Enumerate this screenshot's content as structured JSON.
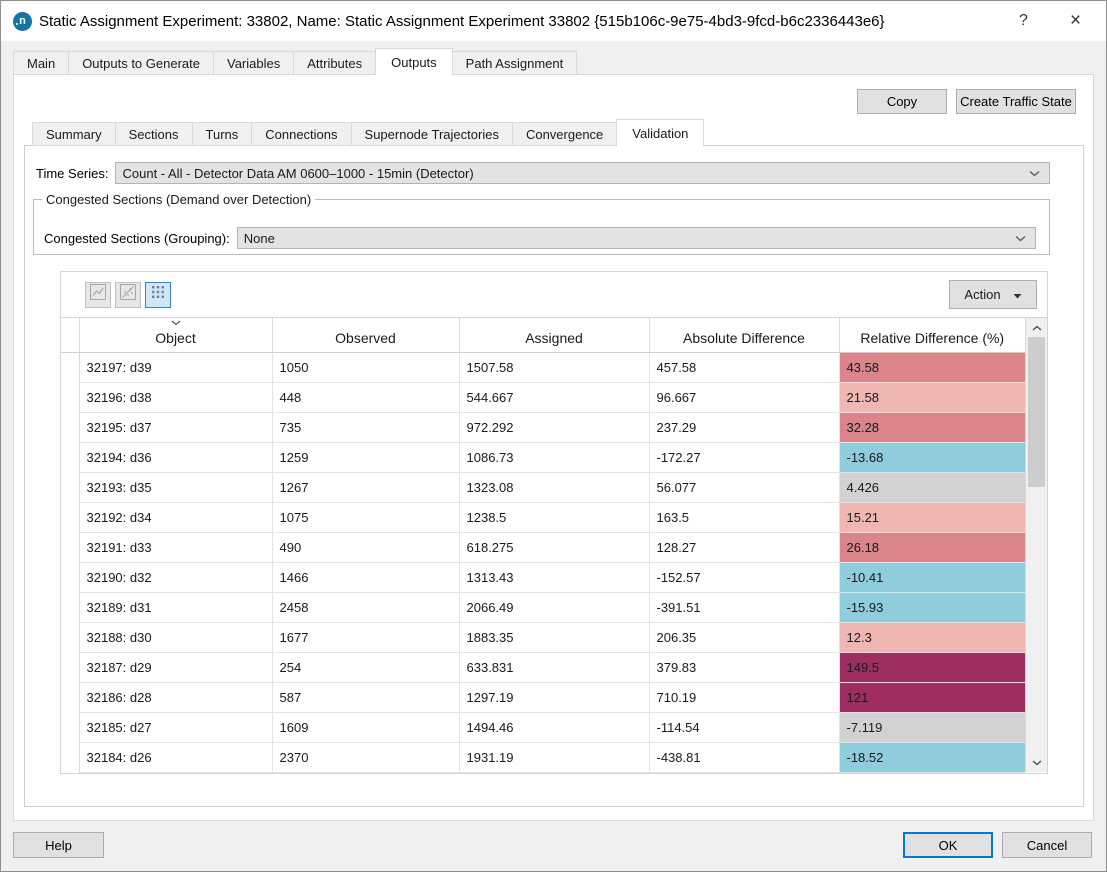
{
  "window": {
    "icon_letter": "n",
    "title": "Static Assignment Experiment: 33802, Name: Static Assignment Experiment 33802  {515b106c-9e75-4bd3-9fcd-b6c2336443e6}",
    "help_glyph": "?",
    "close_glyph": "×"
  },
  "top_tabs": [
    {
      "label": "Main",
      "active": false
    },
    {
      "label": "Outputs to Generate",
      "active": false
    },
    {
      "label": "Variables",
      "active": false
    },
    {
      "label": "Attributes",
      "active": false
    },
    {
      "label": "Outputs",
      "active": true
    },
    {
      "label": "Path Assignment",
      "active": false
    }
  ],
  "page_actions": {
    "copy": "Copy",
    "create_traffic_state": "Create Traffic State"
  },
  "output_tabs": [
    {
      "label": "Summary",
      "active": false
    },
    {
      "label": "Sections",
      "active": false
    },
    {
      "label": "Turns",
      "active": false
    },
    {
      "label": "Connections",
      "active": false
    },
    {
      "label": "Supernode Trajectories",
      "active": false
    },
    {
      "label": "Convergence",
      "active": false
    },
    {
      "label": "Validation",
      "active": true
    }
  ],
  "time_series": {
    "label": "Time Series:",
    "value": "Count - All - Detector Data AM 0600–1000 - 15min (Detector)"
  },
  "congested_sections": {
    "group_title": "Congested Sections (Demand over Detection)",
    "grouping_label": "Congested Sections (Grouping):",
    "grouping_value": "None"
  },
  "toolbar": {
    "buttons": [
      {
        "name": "line-chart",
        "enabled": false,
        "selected": false
      },
      {
        "name": "scatter-plot",
        "enabled": false,
        "selected": false
      },
      {
        "name": "table-grid",
        "enabled": true,
        "selected": true
      }
    ],
    "action_label": "Action"
  },
  "table": {
    "columns": [
      "Object",
      "Observed",
      "Assigned",
      "Absolute Difference",
      "Relative Difference (%)"
    ],
    "sorted_column": "Object",
    "sort_direction": "descending",
    "rows": [
      {
        "object": "32197: d39",
        "observed": "1050",
        "assigned": "1507.58",
        "abs_diff": "457.58",
        "rel_diff": "43.58",
        "rel_color": "#db858b"
      },
      {
        "object": "32196: d38",
        "observed": "448",
        "assigned": "544.667",
        "abs_diff": "96.667",
        "rel_diff": "21.58",
        "rel_color": "#f0b7b2"
      },
      {
        "object": "32195: d37",
        "observed": "735",
        "assigned": "972.292",
        "abs_diff": "237.29",
        "rel_diff": "32.28",
        "rel_color": "#db858b"
      },
      {
        "object": "32194: d36",
        "observed": "1259",
        "assigned": "1086.73",
        "abs_diff": "-172.27",
        "rel_diff": "-13.68",
        "rel_color": "#8fcddd"
      },
      {
        "object": "32193: d35",
        "observed": "1267",
        "assigned": "1323.08",
        "abs_diff": "56.077",
        "rel_diff": "4.426",
        "rel_color": "#d2d2d2"
      },
      {
        "object": "32192: d34",
        "observed": "1075",
        "assigned": "1238.5",
        "abs_diff": "163.5",
        "rel_diff": "15.21",
        "rel_color": "#f0b7b2"
      },
      {
        "object": "32191: d33",
        "observed": "490",
        "assigned": "618.275",
        "abs_diff": "128.27",
        "rel_diff": "26.18",
        "rel_color": "#db858b"
      },
      {
        "object": "32190: d32",
        "observed": "1466",
        "assigned": "1313.43",
        "abs_diff": "-152.57",
        "rel_diff": "-10.41",
        "rel_color": "#8fcddd"
      },
      {
        "object": "32189: d31",
        "observed": "2458",
        "assigned": "2066.49",
        "abs_diff": "-391.51",
        "rel_diff": "-15.93",
        "rel_color": "#8fcddd"
      },
      {
        "object": "32188: d30",
        "observed": "1677",
        "assigned": "1883.35",
        "abs_diff": "206.35",
        "rel_diff": "12.3",
        "rel_color": "#f0b7b2"
      },
      {
        "object": "32187: d29",
        "observed": "254",
        "assigned": "633.831",
        "abs_diff": "379.83",
        "rel_diff": "149.5",
        "rel_color": "#9d2e5f"
      },
      {
        "object": "32186: d28",
        "observed": "587",
        "assigned": "1297.19",
        "abs_diff": "710.19",
        "rel_diff": "121",
        "rel_color": "#9d2e5f"
      },
      {
        "object": "32185: d27",
        "observed": "1609",
        "assigned": "1494.46",
        "abs_diff": "-114.54",
        "rel_diff": "-7.119",
        "rel_color": "#d2d2d2"
      },
      {
        "object": "32184: d26",
        "observed": "2370",
        "assigned": "1931.19",
        "abs_diff": "-438.81",
        "rel_diff": "-18.52",
        "rel_color": "#8fcddd"
      }
    ]
  },
  "footer": {
    "help": "Help",
    "ok": "OK",
    "cancel": "Cancel"
  },
  "colors": {
    "accent_blue": "#0078d7",
    "cell_strong_over": "#db858b",
    "cell_mild_over": "#f0b7b2",
    "cell_neutral": "#d2d2d2",
    "cell_under": "#8fcddd",
    "cell_extreme_over": "#9d2e5f"
  }
}
